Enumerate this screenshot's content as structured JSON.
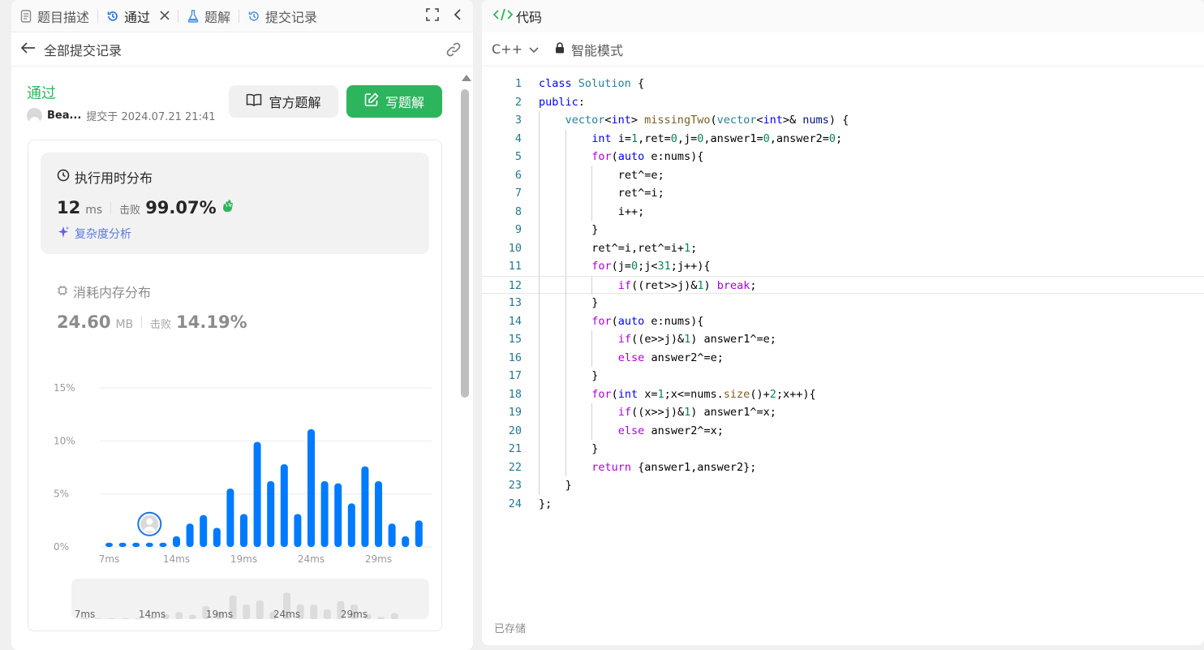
{
  "left_panel": {
    "tabs": [
      {
        "label": "题目描述",
        "icon": "document-icon"
      },
      {
        "label": "通过",
        "icon": "history-icon",
        "active": true
      },
      {
        "label": "题解",
        "icon": "flask-icon"
      },
      {
        "label": "提交记录",
        "icon": "history-icon"
      }
    ],
    "back_label": "全部提交记录",
    "status": "通过",
    "user_name": "Bea...",
    "submitted_at": "提交于 2024.07.21 21:41",
    "official_solution_label": "官方题解",
    "write_solution_label": "写题解",
    "runtime": {
      "title": "执行用时分布",
      "value": "12",
      "unit": "ms",
      "beat_label": "击败",
      "beat_pct": "99.07%",
      "complexity_label": "复杂度分析"
    },
    "memory": {
      "title": "消耗内存分布",
      "value": "24.60",
      "unit": "MB",
      "beat_label": "击败",
      "beat_pct": "14.19%"
    },
    "mini_ticks": [
      "7ms",
      "14ms",
      "19ms",
      "24ms",
      "29ms"
    ]
  },
  "chart_data": {
    "type": "bar",
    "ylabels": [
      "15%",
      "10%",
      "5%",
      "0%"
    ],
    "yticks": [
      15,
      10,
      5,
      0
    ],
    "ylim": [
      0,
      15
    ],
    "xticks": [
      {
        "label": "7ms",
        "index": 0
      },
      {
        "label": "14ms",
        "index": 5
      },
      {
        "label": "19ms",
        "index": 10
      },
      {
        "label": "24ms",
        "index": 15
      },
      {
        "label": "29ms",
        "index": 20
      }
    ],
    "categories": [
      "7ms",
      "8ms",
      "9ms",
      "10ms",
      "11ms",
      "12ms",
      "13ms",
      "14ms",
      "15ms",
      "16ms",
      "17ms",
      "18ms",
      "19ms",
      "20ms",
      "21ms",
      "22ms",
      "23ms",
      "24ms",
      "25ms",
      "26ms",
      "27ms",
      "28ms",
      "29ms",
      "30ms",
      "31ms"
    ],
    "values": [
      0.4,
      0.4,
      0.4,
      0.4,
      0.4,
      1.0,
      2.2,
      3.0,
      1.8,
      5.5,
      3.1,
      9.9,
      6.2,
      7.8,
      3.1,
      11.1,
      6.2,
      6.0,
      4.1,
      7.6,
      6.2,
      2.2,
      1.0,
      2.5
    ],
    "user_marker_index": 3,
    "color": "#007aff"
  },
  "right_panel": {
    "title": "代码",
    "language": "C++",
    "mode_label": "智能模式",
    "saved_label": "已存储",
    "current_line": 12
  },
  "code_lines": [
    {
      "indent": 0,
      "tokens": [
        [
          "k",
          "class"
        ],
        [
          "",
          "",
          " "
        ],
        [
          "t",
          "Solution"
        ],
        [
          "",
          " {"
        ]
      ]
    },
    {
      "indent": 0,
      "tokens": [
        [
          "k",
          "public"
        ],
        [
          "",
          ":"
        ]
      ]
    },
    {
      "indent": 1,
      "tokens": [
        [
          "t",
          "vector"
        ],
        [
          "",
          "<"
        ],
        [
          "k",
          "int"
        ],
        [
          "",
          "> "
        ],
        [
          "f",
          "missingTwo"
        ],
        [
          "",
          "("
        ],
        [
          "t",
          "vector"
        ],
        [
          "",
          "<"
        ],
        [
          "k",
          "int"
        ],
        [
          "",
          ">& "
        ],
        [
          "v",
          "nums"
        ],
        [
          "",
          ") {"
        ]
      ]
    },
    {
      "indent": 2,
      "tokens": [
        [
          "k",
          "int"
        ],
        [
          "",
          " i="
        ],
        [
          "n",
          "1"
        ],
        [
          "",
          ",ret="
        ],
        [
          "n",
          "0"
        ],
        [
          "",
          ",j="
        ],
        [
          "n",
          "0"
        ],
        [
          "",
          ",answer1="
        ],
        [
          "n",
          "0"
        ],
        [
          "",
          ",answer2="
        ],
        [
          "n",
          "0"
        ],
        [
          "",
          ";"
        ]
      ]
    },
    {
      "indent": 2,
      "tokens": [
        [
          "p",
          "for"
        ],
        [
          "",
          "("
        ],
        [
          "k",
          "auto"
        ],
        [
          "",
          " e:nums){"
        ]
      ]
    },
    {
      "indent": 3,
      "tokens": [
        [
          "",
          "ret^=e;"
        ]
      ]
    },
    {
      "indent": 3,
      "tokens": [
        [
          "",
          "ret^=i;"
        ]
      ]
    },
    {
      "indent": 3,
      "tokens": [
        [
          "",
          "i++;"
        ]
      ]
    },
    {
      "indent": 2,
      "tokens": [
        [
          "",
          "}"
        ]
      ]
    },
    {
      "indent": 2,
      "tokens": [
        [
          "",
          "ret^=i,ret^=i+"
        ],
        [
          "n",
          "1"
        ],
        [
          "",
          ";"
        ]
      ]
    },
    {
      "indent": 2,
      "tokens": [
        [
          "p",
          "for"
        ],
        [
          "",
          "(j="
        ],
        [
          "n",
          "0"
        ],
        [
          "",
          ";j<"
        ],
        [
          "n",
          "31"
        ],
        [
          "",
          ";j++){"
        ]
      ]
    },
    {
      "indent": 3,
      "tokens": [
        [
          "p",
          "if"
        ],
        [
          "",
          "((ret>>j)&"
        ],
        [
          "n",
          "1"
        ],
        [
          "",
          ") "
        ],
        [
          "p",
          "break"
        ],
        [
          "",
          ";"
        ]
      ]
    },
    {
      "indent": 2,
      "tokens": [
        [
          "",
          "}"
        ]
      ]
    },
    {
      "indent": 2,
      "tokens": [
        [
          "p",
          "for"
        ],
        [
          "",
          "("
        ],
        [
          "k",
          "auto"
        ],
        [
          "",
          " e:nums){"
        ]
      ]
    },
    {
      "indent": 3,
      "tokens": [
        [
          "p",
          "if"
        ],
        [
          "",
          "((e>>j)&"
        ],
        [
          "n",
          "1"
        ],
        [
          "",
          ") answer1^=e;"
        ]
      ]
    },
    {
      "indent": 3,
      "tokens": [
        [
          "p",
          "else"
        ],
        [
          "",
          " answer2^=e;"
        ]
      ]
    },
    {
      "indent": 2,
      "tokens": [
        [
          "",
          "}"
        ]
      ]
    },
    {
      "indent": 2,
      "tokens": [
        [
          "p",
          "for"
        ],
        [
          "",
          "("
        ],
        [
          "k",
          "int"
        ],
        [
          "",
          " x="
        ],
        [
          "n",
          "1"
        ],
        [
          "",
          ";x<=nums."
        ],
        [
          "f",
          "size"
        ],
        [
          "",
          "()+"
        ],
        [
          "n",
          "2"
        ],
        [
          "",
          ";x++){"
        ]
      ]
    },
    {
      "indent": 3,
      "tokens": [
        [
          "p",
          "if"
        ],
        [
          "",
          "((x>>j)&"
        ],
        [
          "n",
          "1"
        ],
        [
          "",
          ") answer1^=x;"
        ]
      ]
    },
    {
      "indent": 3,
      "tokens": [
        [
          "p",
          "else"
        ],
        [
          "",
          " answer2^=x;"
        ]
      ]
    },
    {
      "indent": 2,
      "tokens": [
        [
          "",
          "}"
        ]
      ]
    },
    {
      "indent": 2,
      "tokens": [
        [
          "p",
          "return"
        ],
        [
          "",
          " {answer1,answer2};"
        ]
      ]
    },
    {
      "indent": 1,
      "tokens": [
        [
          "",
          "}"
        ]
      ]
    },
    {
      "indent": 0,
      "tokens": [
        [
          "",
          "};"
        ]
      ]
    }
  ]
}
